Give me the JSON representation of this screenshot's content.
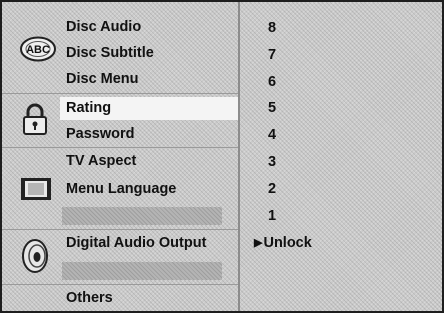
{
  "menu": {
    "items": [
      {
        "label": "Disc Audio"
      },
      {
        "label": "Disc Subtitle"
      },
      {
        "label": "Disc Menu"
      },
      {
        "label": "Rating"
      },
      {
        "label": "Password"
      },
      {
        "label": "TV Aspect"
      },
      {
        "label": "Menu Language"
      },
      {
        "label": "Digital Audio Output"
      },
      {
        "label": "Others"
      }
    ],
    "selected": "Rating"
  },
  "icons": {
    "language": "abc-disc-icon",
    "lock": "padlock-icon",
    "display": "tv-screen-icon",
    "audio": "speaker-icon"
  },
  "abc_icon_text": "ABC",
  "options": {
    "items": [
      "8",
      "7",
      "6",
      "5",
      "4",
      "3",
      "2",
      "1",
      "Unlock"
    ],
    "selected": "Unlock",
    "arrow": "▶"
  }
}
